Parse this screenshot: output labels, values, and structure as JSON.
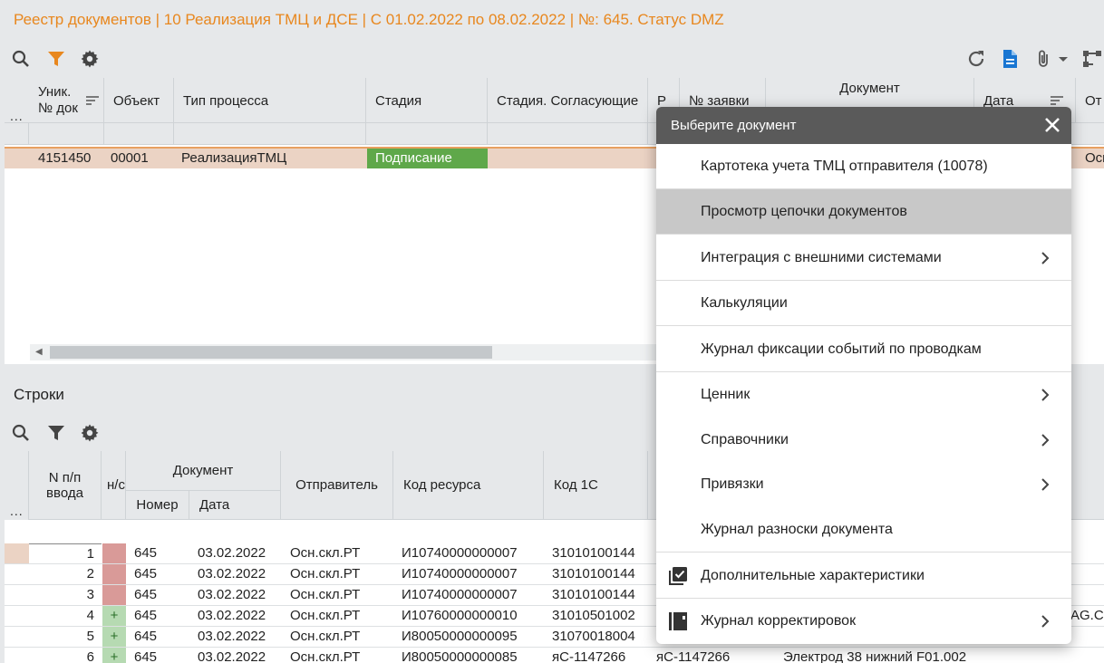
{
  "window_title": "Реестр документов | 10 Реализация ТМЦ и ДСЕ | С 01.02.2022 по 08.02.2022 | №: 645. Статус DMZ",
  "colors": {
    "accent": "#e8871e",
    "stage_green": "#5fa84a",
    "doc_blue": "#1976d2",
    "selected_row": "#ebd3c4"
  },
  "top_toolbar": {
    "left_icons": [
      "search-icon",
      "filter-icon",
      "gear-icon"
    ],
    "right_icons": [
      "refresh-icon",
      "document-icon",
      "attachment-icon",
      "dropdown-arrow-icon",
      "diagram-icon"
    ]
  },
  "top_grid": {
    "row_menu": "...",
    "columns": {
      "uid": "Уник.\n№ док",
      "object": "Объект",
      "process_type": "Тип процесса",
      "stage": "Стадия",
      "stage_approvers": "Стадия. Согласующие",
      "p": "Р",
      "request_no": "№ заявки",
      "document": "Документ",
      "date": "Дата",
      "from": "От"
    },
    "row": {
      "uid": "4151450",
      "object": "00001",
      "process_type": "РеализацияТМЦ",
      "stage": "Подписание",
      "from": "Осн"
    }
  },
  "bottom": {
    "title": "Строки",
    "toolbar_icons": [
      "search-icon",
      "filter-icon",
      "gear-icon"
    ],
    "columns": {
      "row_menu": "...",
      "line_no": "N п/п\nввода",
      "nc": "н/с",
      "document": "Документ",
      "doc_number": "Номер",
      "doc_date": "Дата",
      "sender": "Отправитель",
      "resource_code": "Код ресурса",
      "code_1c": "Код 1С"
    },
    "rows": [
      {
        "n": "1",
        "flag": "",
        "flag_color": "red",
        "number": "645",
        "date": "03.02.2022",
        "sender": "Осн.скл.РТ",
        "resource": "И10740000000007",
        "code1c": "31010100144",
        "extra1": "",
        "extra2": ""
      },
      {
        "n": "2",
        "flag": "",
        "flag_color": "red",
        "number": "645",
        "date": "03.02.2022",
        "sender": "Осн.скл.РТ",
        "resource": "И10740000000007",
        "code1c": "31010100144",
        "extra1": "",
        "extra2": ""
      },
      {
        "n": "3",
        "flag": "",
        "flag_color": "red",
        "number": "645",
        "date": "03.02.2022",
        "sender": "Осн.скл.РТ",
        "resource": "И10740000000007",
        "code1c": "31010100144",
        "extra1": "",
        "extra2": ""
      },
      {
        "n": "4",
        "flag": "+",
        "flag_color": "green",
        "number": "645",
        "date": "03.02.2022",
        "sender": "Осн.скл.РТ",
        "resource": "И10760000000010",
        "code1c": "31010501002",
        "extra1": "",
        "extra2": "AG.C"
      },
      {
        "n": "5",
        "flag": "+",
        "flag_color": "green",
        "number": "645",
        "date": "03.02.2022",
        "sender": "Осн.скл.РТ",
        "resource": "И80050000000095",
        "code1c": "31070018004",
        "extra1": "",
        "extra2": ""
      },
      {
        "n": "6",
        "flag": "+",
        "flag_color": "green",
        "number": "645",
        "date": "03.02.2022",
        "sender": "Осн.скл.РТ",
        "resource": "И80050000000085",
        "code1c": "яС-1147266",
        "extra1": "яС-1147266",
        "extra2": "Электрод 38 нижний F01.002"
      }
    ]
  },
  "popup": {
    "title": "Выберите документ",
    "items": [
      {
        "label": "Картотека учета ТМЦ отправителя (10078)",
        "submenu": false,
        "icon": ""
      },
      {
        "label": "Просмотр цепочки документов",
        "submenu": false,
        "icon": "",
        "highlighted": true
      },
      {
        "label": "Интеграция с внешними системами",
        "submenu": true,
        "icon": ""
      },
      {
        "label": "Калькуляции",
        "submenu": false,
        "icon": ""
      },
      {
        "label": "Журнал фиксации событий по проводкам",
        "submenu": false,
        "icon": ""
      },
      {
        "label": "Ценник",
        "submenu": true,
        "icon": ""
      },
      {
        "label": "Справочники",
        "submenu": true,
        "icon": ""
      },
      {
        "label": "Привязки",
        "submenu": true,
        "icon": ""
      },
      {
        "label": "Журнал разноски документа",
        "submenu": false,
        "icon": ""
      },
      {
        "label": "Дополнительные характеристики",
        "submenu": false,
        "icon": "checklist-icon"
      },
      {
        "label": "Журнал корректировок",
        "submenu": true,
        "icon": "notebook-icon"
      }
    ]
  }
}
